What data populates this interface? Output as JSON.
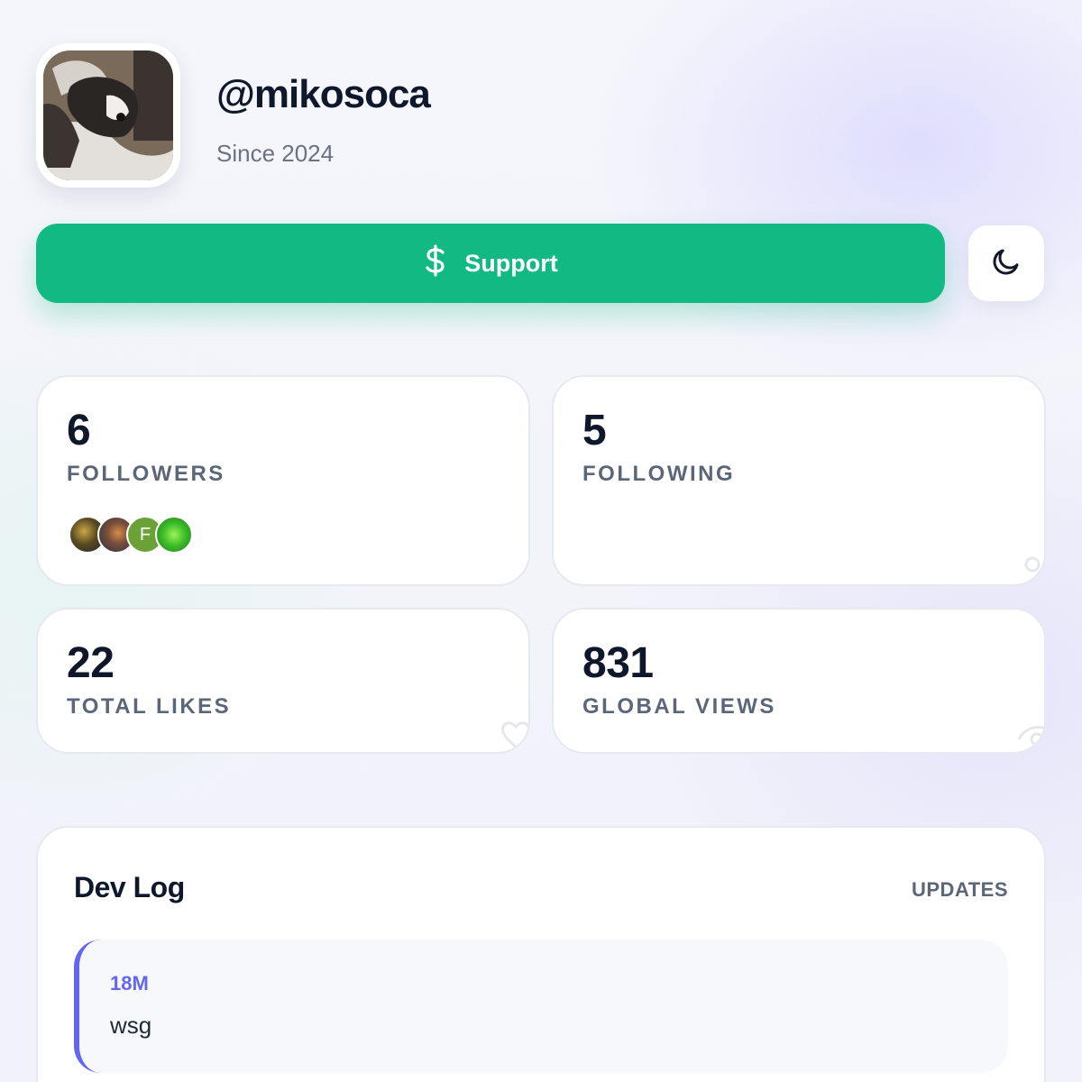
{
  "profile": {
    "username": "@mikosoca",
    "since": "Since 2024",
    "avatar_icon": "profile-photo-dog"
  },
  "actions": {
    "support_label": "Support",
    "support_icon": "dollar-icon",
    "support_color": "#13b983",
    "theme_icon": "moon-icon"
  },
  "stats": {
    "followers": {
      "value": "6",
      "label": "FOLLOWERS"
    },
    "following": {
      "value": "5",
      "label": "FOLLOWING"
    },
    "likes": {
      "value": "22",
      "label": "TOTAL LIKES"
    },
    "views": {
      "value": "831",
      "label": "GLOBAL VIEWS"
    }
  },
  "followers_preview": [
    {
      "type": "image",
      "icon": "follower-avatar"
    },
    {
      "type": "image",
      "icon": "follower-avatar"
    },
    {
      "type": "initial",
      "initial": "F",
      "color": "#6aa238"
    },
    {
      "type": "image",
      "icon": "follower-avatar"
    }
  ],
  "devlog": {
    "title": "Dev Log",
    "updates_label": "UPDATES",
    "accent_color": "#6366f1",
    "entries": [
      {
        "time": "18M",
        "text": "wsg"
      }
    ]
  }
}
